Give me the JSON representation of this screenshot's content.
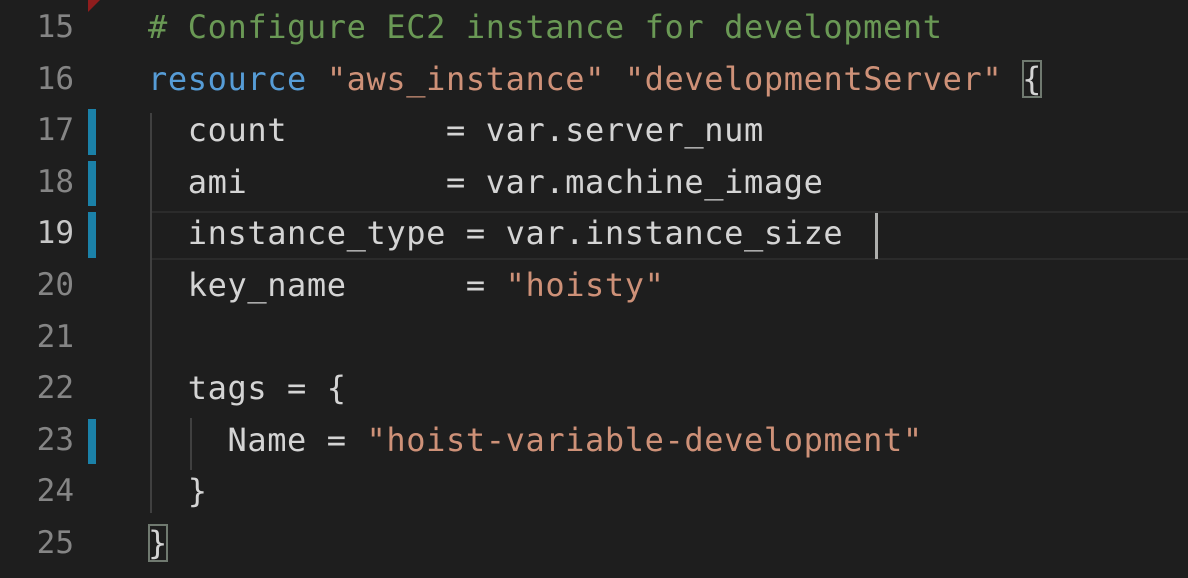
{
  "editor": {
    "lines": [
      {
        "num": "15",
        "parts": [
          {
            "t": "# Configure EC2 instance for development",
            "c": "cmt"
          }
        ]
      },
      {
        "num": "16",
        "parts": [
          {
            "t": "resource",
            "c": "kw"
          },
          {
            "t": " ",
            "c": "plain"
          },
          {
            "t": "\"aws_instance\"",
            "c": "str"
          },
          {
            "t": " ",
            "c": "plain"
          },
          {
            "t": "\"developmentServer\"",
            "c": "str"
          },
          {
            "t": " ",
            "c": "plain"
          },
          {
            "t": "{",
            "c": "plain bracket-box"
          }
        ]
      },
      {
        "num": "17",
        "parts": [
          {
            "t": "  count        = var.server_num",
            "c": "plain"
          }
        ]
      },
      {
        "num": "18",
        "parts": [
          {
            "t": "  ami          = var.machine_image",
            "c": "plain"
          }
        ]
      },
      {
        "num": "19",
        "parts": [
          {
            "t": "  instance_type = var.instance_size",
            "c": "plain"
          }
        ]
      },
      {
        "num": "20",
        "parts": [
          {
            "t": "  key_name      = ",
            "c": "plain"
          },
          {
            "t": "\"hoisty\"",
            "c": "str"
          }
        ]
      },
      {
        "num": "21",
        "parts": []
      },
      {
        "num": "22",
        "parts": [
          {
            "t": "  tags = {",
            "c": "plain"
          }
        ]
      },
      {
        "num": "23",
        "parts": [
          {
            "t": "    Name = ",
            "c": "plain"
          },
          {
            "t": "\"hoist-variable-development\"",
            "c": "str"
          }
        ]
      },
      {
        "num": "24",
        "parts": [
          {
            "t": "  }",
            "c": "plain"
          }
        ]
      },
      {
        "num": "25",
        "parts": [
          {
            "t": "}",
            "c": "plain bracket-box"
          }
        ]
      }
    ],
    "active_line": "19",
    "changed_lines": [
      "17",
      "18",
      "19",
      "23"
    ],
    "colors": {
      "background": "#1e1e1e",
      "comment": "#6a9955",
      "keyword": "#569cd6",
      "string": "#ce9178",
      "text": "#d4d4d4",
      "line_number": "#858585",
      "change_bar": "#1b81a8"
    }
  }
}
